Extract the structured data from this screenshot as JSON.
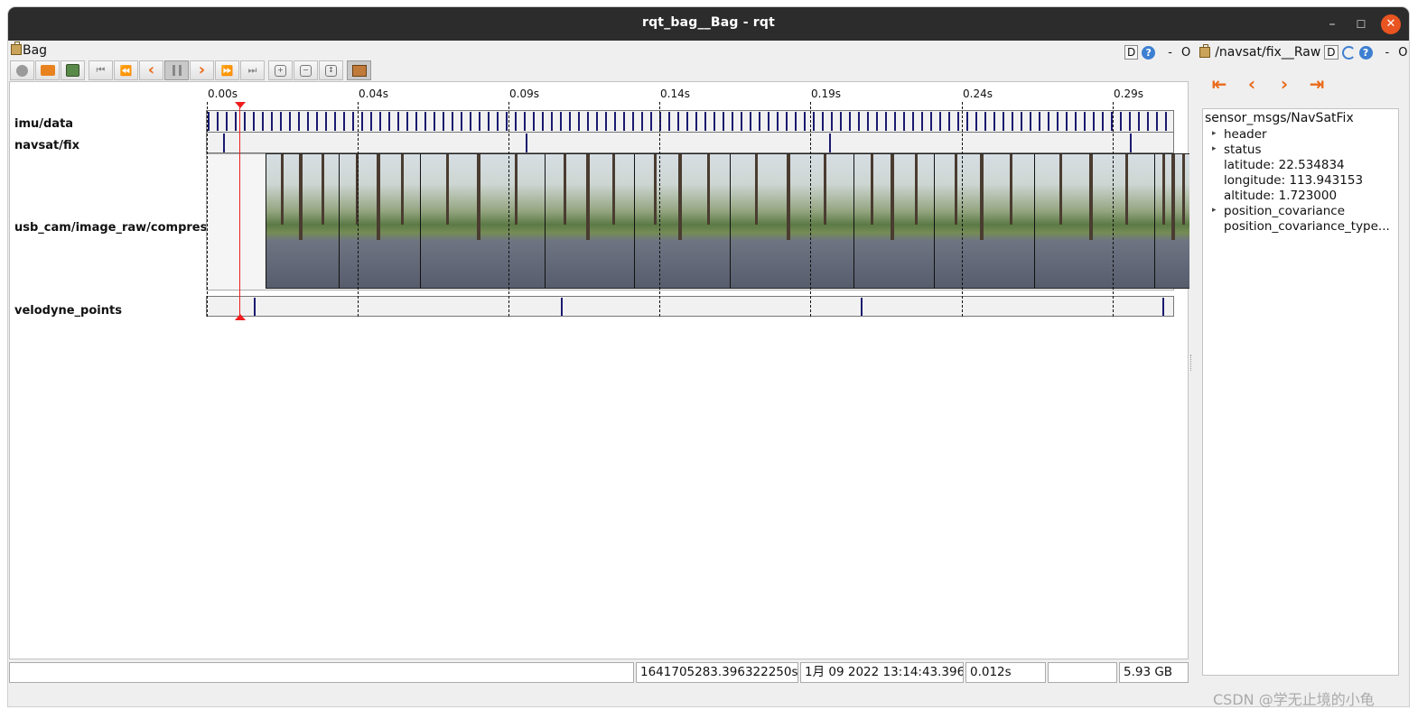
{
  "window": {
    "title": "rqt_bag__Bag - rqt",
    "min_glyph": "–",
    "max_glyph": "☐",
    "close_glyph": "✕"
  },
  "header_left": {
    "label": "Bag"
  },
  "header_right": {
    "d_label": "D",
    "q_label": "?",
    "dash": "-",
    "o_label": "O",
    "plugin_label": "/navsat/fix__Raw",
    "d2_label": "D",
    "q2_label": "?",
    "dash2": "-",
    "o2_label": "O",
    "x_label": "✕"
  },
  "toolbar": {
    "icons": [
      "record-icon",
      "open-icon",
      "save-icon",
      "go-to-begin-icon",
      "rewind-icon",
      "step-back-icon",
      "pause-icon",
      "step-forward-icon",
      "fast-forward-icon",
      "go-to-end-icon",
      "zoom-in-icon",
      "zoom-out-icon",
      "zoom-fit-icon",
      "thumbnails-icon"
    ]
  },
  "timeline": {
    "tick_labels": [
      "0.00s",
      "0.04s",
      "0.09s",
      "0.14s",
      "0.19s",
      "0.24s",
      "0.29s"
    ],
    "topics": [
      "imu/data",
      "navsat/fix",
      "usb_cam/image_raw/compressed",
      "velodyne_points"
    ]
  },
  "message": {
    "type": "sensor_msgs/NavSatFix",
    "fields": [
      {
        "text": "header",
        "expandable": true
      },
      {
        "text": "status",
        "expandable": true
      },
      {
        "text": "latitude:  22.534834",
        "expandable": false
      },
      {
        "text": "longitude:  113.943153",
        "expandable": false
      },
      {
        "text": "altitude:  1.723000",
        "expandable": false
      },
      {
        "text": "position_covariance",
        "expandable": true
      },
      {
        "text": "position_covariance_type...",
        "expandable": false
      }
    ],
    "expander_glyph": "▸"
  },
  "nav": {
    "first": "⇤",
    "prev": "‹",
    "next": "›",
    "last": "⇥"
  },
  "status": {
    "message": "",
    "stamp": "1641705283.396322250s",
    "date": "1月 09 2022 13:14:43.396",
    "duration": "0.012s",
    "empty": "",
    "size": "5.93 GB"
  },
  "watermark": "CSDN @学无止境的小龟"
}
